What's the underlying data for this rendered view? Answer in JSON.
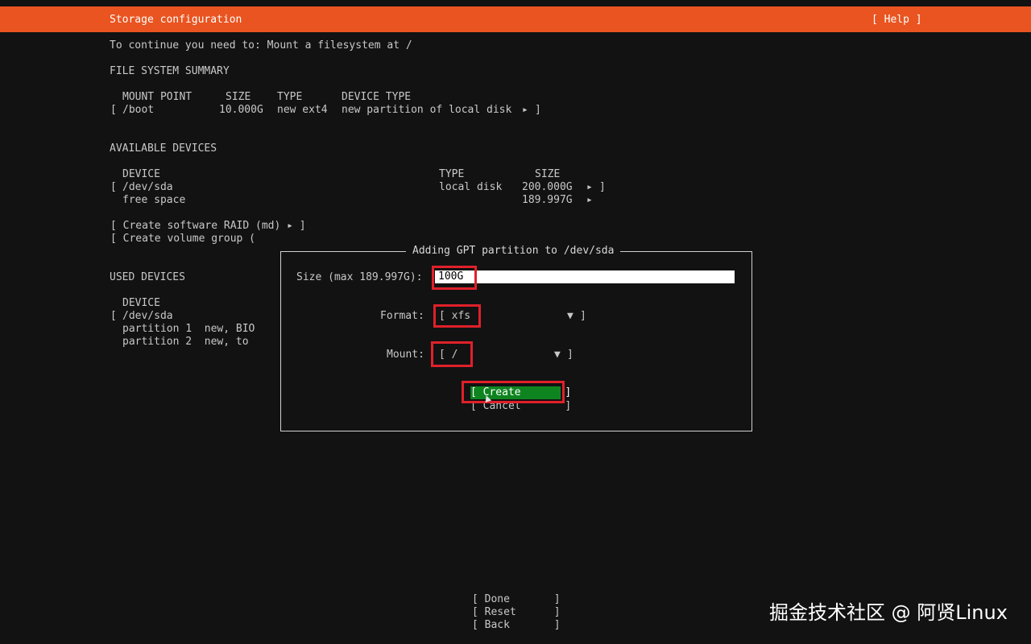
{
  "header": {
    "title": "Storage configuration",
    "help": "[ Help ]"
  },
  "instruction": "To continue you need to: Mount a filesystem at /",
  "fs_summary": {
    "heading": "FILE SYSTEM SUMMARY",
    "columns": [
      "MOUNT POINT",
      "SIZE",
      "TYPE",
      "DEVICE TYPE"
    ],
    "rows": [
      {
        "bracket": "[",
        "mount": "/boot",
        "size": "10.000G",
        "type": "new ext4",
        "device_type": "new partition of local disk",
        "arrow": "▸",
        "close": "]"
      }
    ]
  },
  "available": {
    "heading": "AVAILABLE DEVICES",
    "columns": [
      "DEVICE",
      "TYPE",
      "SIZE"
    ],
    "rows": [
      {
        "bracket": "[",
        "device": "/dev/sda",
        "type": "local disk",
        "size": "200.000G",
        "arrow": "▸",
        "close": "]"
      },
      {
        "device": "free space",
        "size": "189.997G",
        "arrow": "▸"
      }
    ],
    "actions": [
      "[ Create software RAID (md) ▸ ]",
      "[ Create volume group ("
    ]
  },
  "used": {
    "heading": "USED DEVICES",
    "columns": [
      "DEVICE"
    ],
    "bracket": "[",
    "rows": [
      "/dev/sda",
      "partition 1  new, BIO",
      "partition 2  new, to"
    ]
  },
  "dialog": {
    "title": "Adding GPT partition to /dev/sda",
    "size_label": "Size (max 189.997G):",
    "size_value": "100G",
    "format_label": "Format:",
    "format_value": "[ xfs",
    "format_arrow": "▼",
    "format_close": "]",
    "mount_label": "Mount:",
    "mount_value": "[ /",
    "mount_arrow": "▼",
    "mount_close": "]",
    "create": "[ Create       ]",
    "cancel": "[ Cancel       ]"
  },
  "footer": {
    "done": "[ Done       ]",
    "reset": "[ Reset      ]",
    "back": "[ Back       ]"
  },
  "watermark": "掘金技术社区 @ 阿贤Linux",
  "colors": {
    "accent": "#e95420",
    "background": "#121212",
    "button_focus": "#0e8420",
    "highlight": "#e0202a"
  }
}
